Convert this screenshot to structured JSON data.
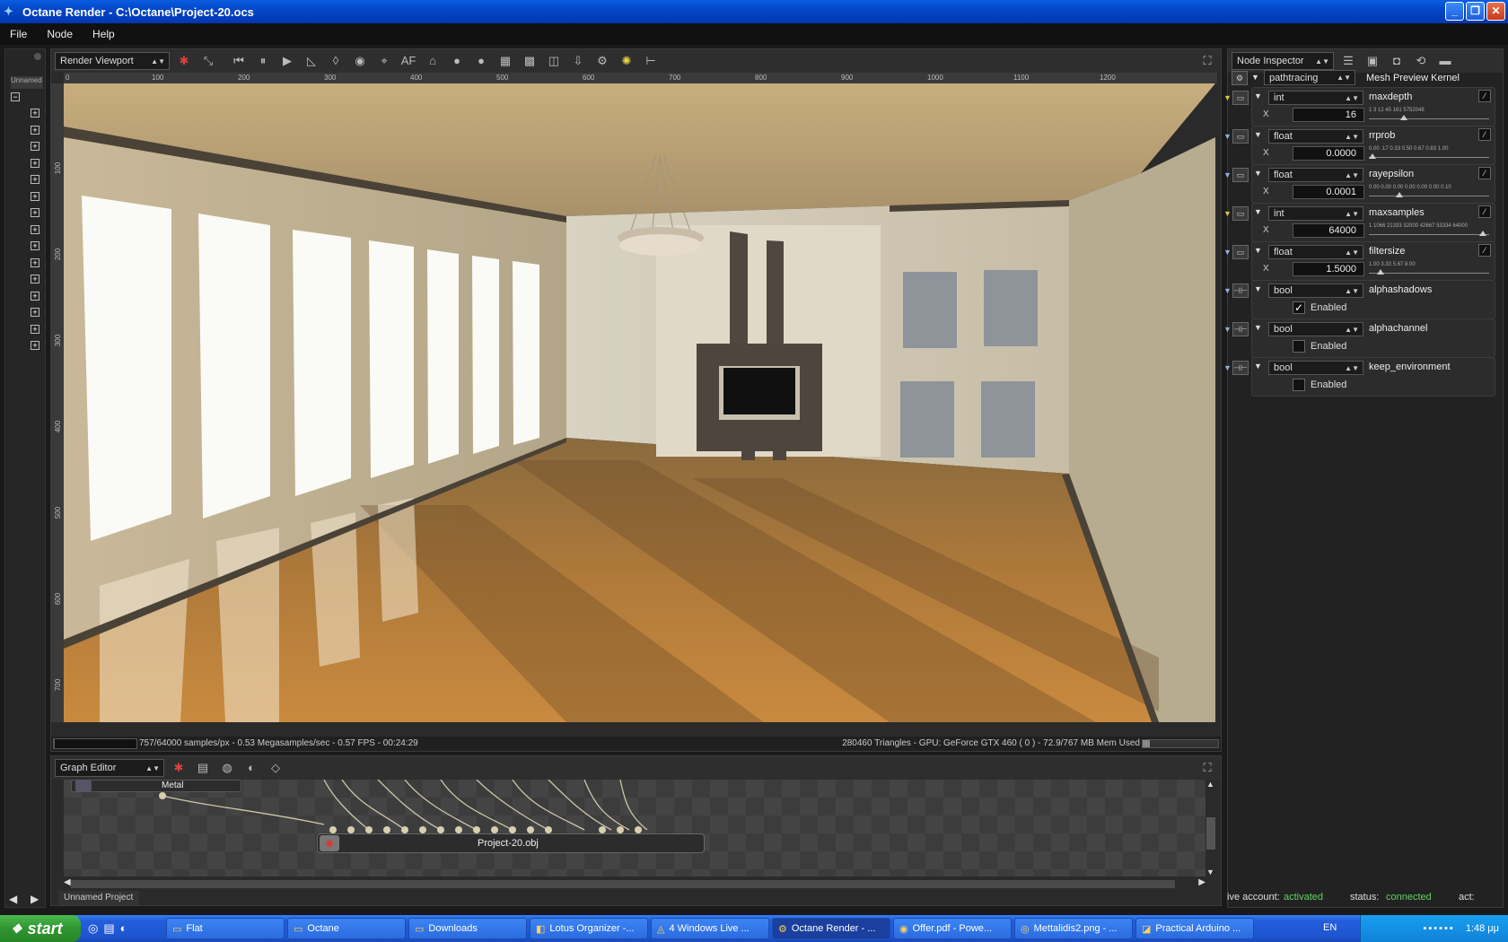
{
  "window": {
    "title": "Octane Render - C:\\Octane\\Project-20.ocs"
  },
  "menu": [
    "File",
    "Node",
    "Help"
  ],
  "left_panel": {
    "tab": "Unnamed"
  },
  "viewport": {
    "combo": "Render Viewport",
    "toolbar_text_af": "AF",
    "ruler_top": [
      "0",
      "100",
      "200",
      "300",
      "400",
      "500",
      "600",
      "700",
      "800",
      "900",
      "1000",
      "1100",
      "1200"
    ],
    "ruler_left": [
      "100",
      "200",
      "300",
      "400",
      "500",
      "600",
      "700"
    ],
    "status_left": "757/64000 samples/px - 0.53 Megasamples/sec - 0.57 FPS - 00:24:29",
    "status_right": "280460 Triangles - GPU: GeForce GTX 460 ( 0 ) - 72.9/767 MB Mem Used",
    "progress": 0.012
  },
  "graph_editor": {
    "combo": "Graph Editor",
    "node_metal": "Metal",
    "node_obj": "Project-20.obj",
    "project_tab": "Unnamed Project"
  },
  "inspector": {
    "combo": "Node Inspector",
    "kernel_combo": "pathtracing",
    "kernel_label": "Mesh Preview Kernel",
    "params": [
      {
        "type": "int",
        "name": "maxdepth",
        "value": "16",
        "ticks": "1  3  12  45  161  5752048",
        "marker": 0.28
      },
      {
        "type": "float",
        "name": "rrprob",
        "value": "0.0000",
        "ticks": "0.00 .17 0.33 0.50 0.67 0.83 1.00",
        "marker": 0.0
      },
      {
        "type": "float",
        "name": "rayepsilon",
        "value": "0.0001",
        "ticks": "0.00 0.00 0.00 0.00 0.00 0.00 0.10",
        "marker": 0.24
      },
      {
        "type": "int",
        "name": "maxsamples",
        "value": "64000",
        "ticks": "1 1066 21333 32000 42667 53334 64000",
        "marker": 0.98
      },
      {
        "type": "float",
        "name": "filtersize",
        "value": "1.5000",
        "ticks": "1.00    3.33    5.67    8.00",
        "marker": 0.07
      }
    ],
    "bools": [
      {
        "type": "bool",
        "name": "alphashadows",
        "label": "Enabled",
        "checked": true
      },
      {
        "type": "bool",
        "name": "alphachannel",
        "label": "Enabled",
        "checked": false
      },
      {
        "type": "bool",
        "name": "keep_environment",
        "label": "Enabled",
        "checked": false
      }
    ],
    "live_account_label": "ive account:",
    "live_account_value": "activated",
    "status_label": "status:",
    "status_value": "connected",
    "act_label": "act:"
  },
  "taskbar": {
    "start": "start",
    "items": [
      "Flat",
      "Octane",
      "Downloads",
      "Lotus Organizer -...",
      "4 Windows Live ...",
      "Octane Render - ...",
      "Offer.pdf - Powe...",
      "Mettalidis2.png - ...",
      "Practical Arduino ..."
    ],
    "lang": "EN",
    "clock": "1:48 μμ"
  },
  "colors": {
    "accent_green": "#5fd35f",
    "titlebar": "#0447c8"
  }
}
